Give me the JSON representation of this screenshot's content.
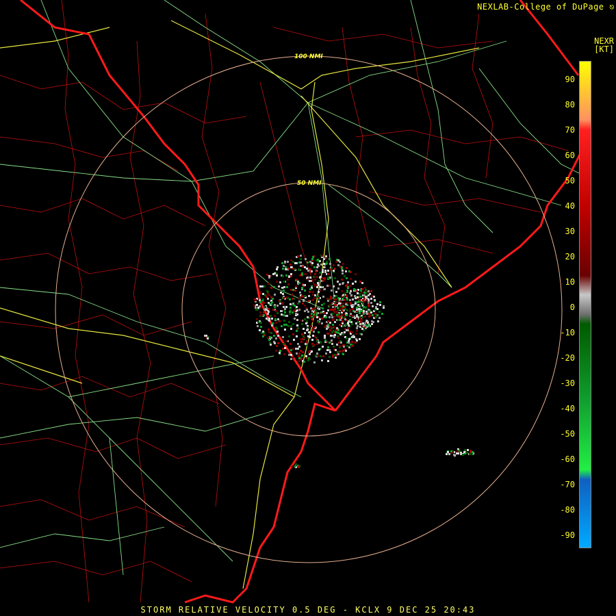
{
  "credit": "NEXLAB-College of DuPage",
  "credit_logo_icon": "cod-logo-icon",
  "product_label": {
    "line1": "NEXR",
    "line2": "[KT]"
  },
  "range_rings": [
    {
      "label": "50 NMI",
      "nmi": 50
    },
    {
      "label": "100 NMI",
      "nmi": 100
    }
  ],
  "colorbar": {
    "unit": "KT",
    "ticks": [
      "90",
      "80",
      "70",
      "60",
      "50",
      "40",
      "30",
      "20",
      "10",
      "0",
      "-10",
      "-20",
      "-30",
      "-40",
      "-50",
      "-60",
      "-70",
      "-80",
      "-90"
    ],
    "colors": {
      "max": "#ffff00",
      "high": "#ff2020",
      "mid_pos": "#6a0000",
      "zero": "#c8c8c8",
      "mid_neg": "#005a00",
      "low": "#22ee44",
      "min": "#00aaff"
    }
  },
  "footer": "STORM RELATIVE VELOCITY 0.5 DEG - KCLX 9 DEC 25 20:43",
  "colors": {
    "state_border": "#ff1a1a",
    "county_line": "#c01010",
    "highway": "#88e088",
    "interstate": "#e6e640",
    "ring": "#e8b090",
    "background": "#000000"
  }
}
